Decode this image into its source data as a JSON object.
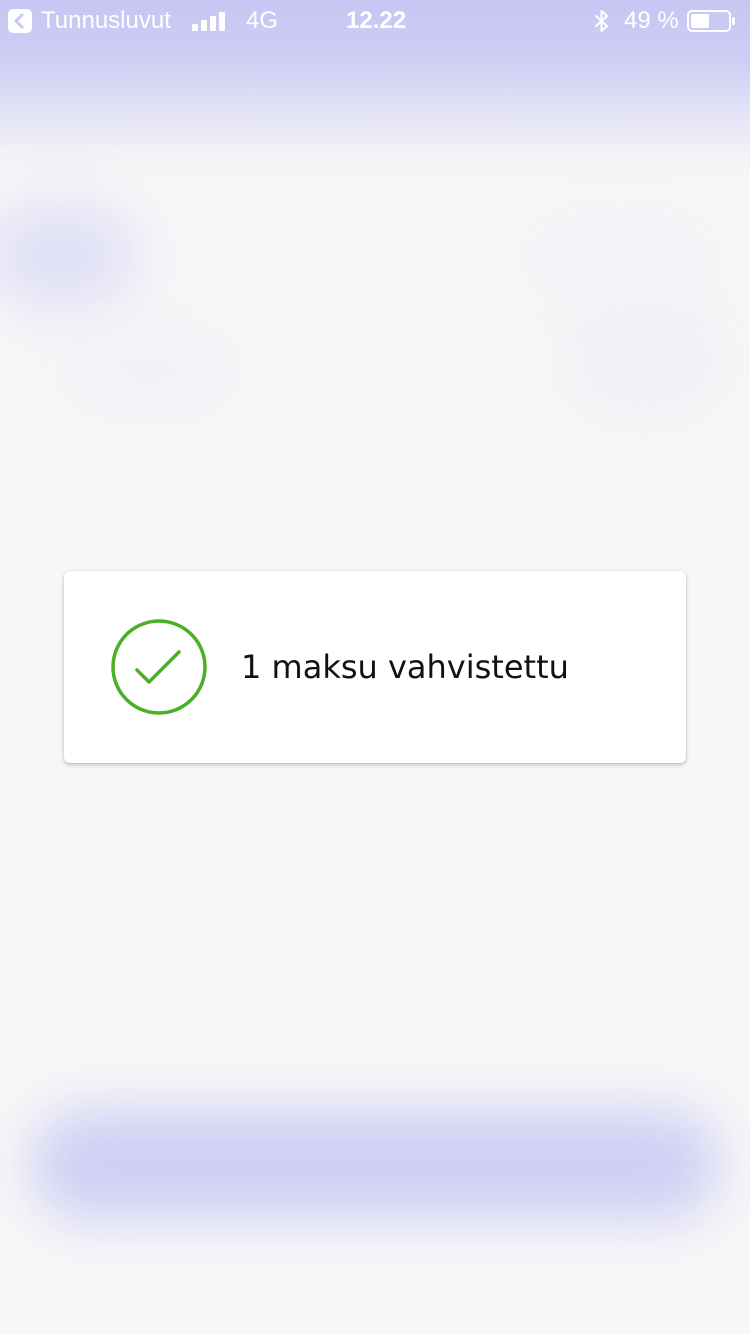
{
  "status_bar": {
    "back_label": "Tunnusluvut",
    "network": "4G",
    "time": "12.22",
    "battery_text": "49 %",
    "battery_level": 0.49,
    "signal_bars_filled": 4
  },
  "toast": {
    "message": "1 maksu vahvistettu",
    "icon": "check-circle-icon",
    "accent_color": "#4caf28"
  },
  "colors": {
    "background": "#f7f7f8",
    "tint": "#c7c6f3"
  }
}
